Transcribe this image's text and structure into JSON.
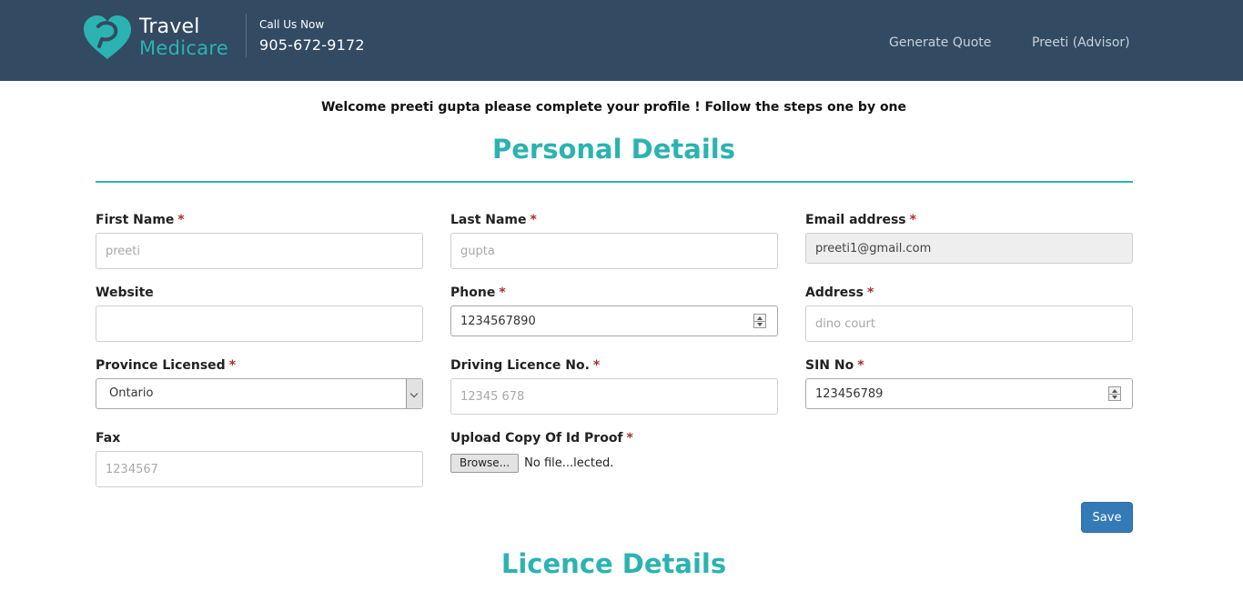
{
  "header": {
    "logo_line1": "Travel",
    "logo_line2": "Medicare",
    "call_label": "Call Us Now",
    "call_number": "905-672-9172",
    "nav": {
      "generate_quote": "Generate Quote",
      "user": "Preeti (Advisor)"
    },
    "colors": {
      "bar": "#324a62",
      "accent": "#2bb3b1"
    }
  },
  "welcome": "Welcome preeti gupta please complete your profile ! Follow the steps one by one",
  "personal": {
    "title": "Personal Details",
    "required_mark": "*",
    "first_name": {
      "label": "First Name",
      "placeholder": "preeti"
    },
    "last_name": {
      "label": "Last Name",
      "placeholder": "gupta"
    },
    "email": {
      "label": "Email address",
      "value": "preeti1@gmail.com"
    },
    "website": {
      "label": "Website",
      "placeholder": ""
    },
    "phone": {
      "label": "Phone",
      "value": "1234567890"
    },
    "address": {
      "label": "Address",
      "placeholder": "dino court"
    },
    "province": {
      "label": "Province Licensed",
      "value": "Ontario"
    },
    "driving_licence": {
      "label": "Driving Licence No.",
      "placeholder": "12345 678"
    },
    "sin": {
      "label": "SIN No",
      "value": "123456789"
    },
    "fax": {
      "label": "Fax",
      "placeholder": "1234567"
    },
    "id_proof": {
      "label": "Upload Copy Of Id Proof",
      "browse": "Browse...",
      "status": "No file...lected."
    },
    "save": "Save"
  },
  "licence": {
    "title": "Licence Details"
  }
}
